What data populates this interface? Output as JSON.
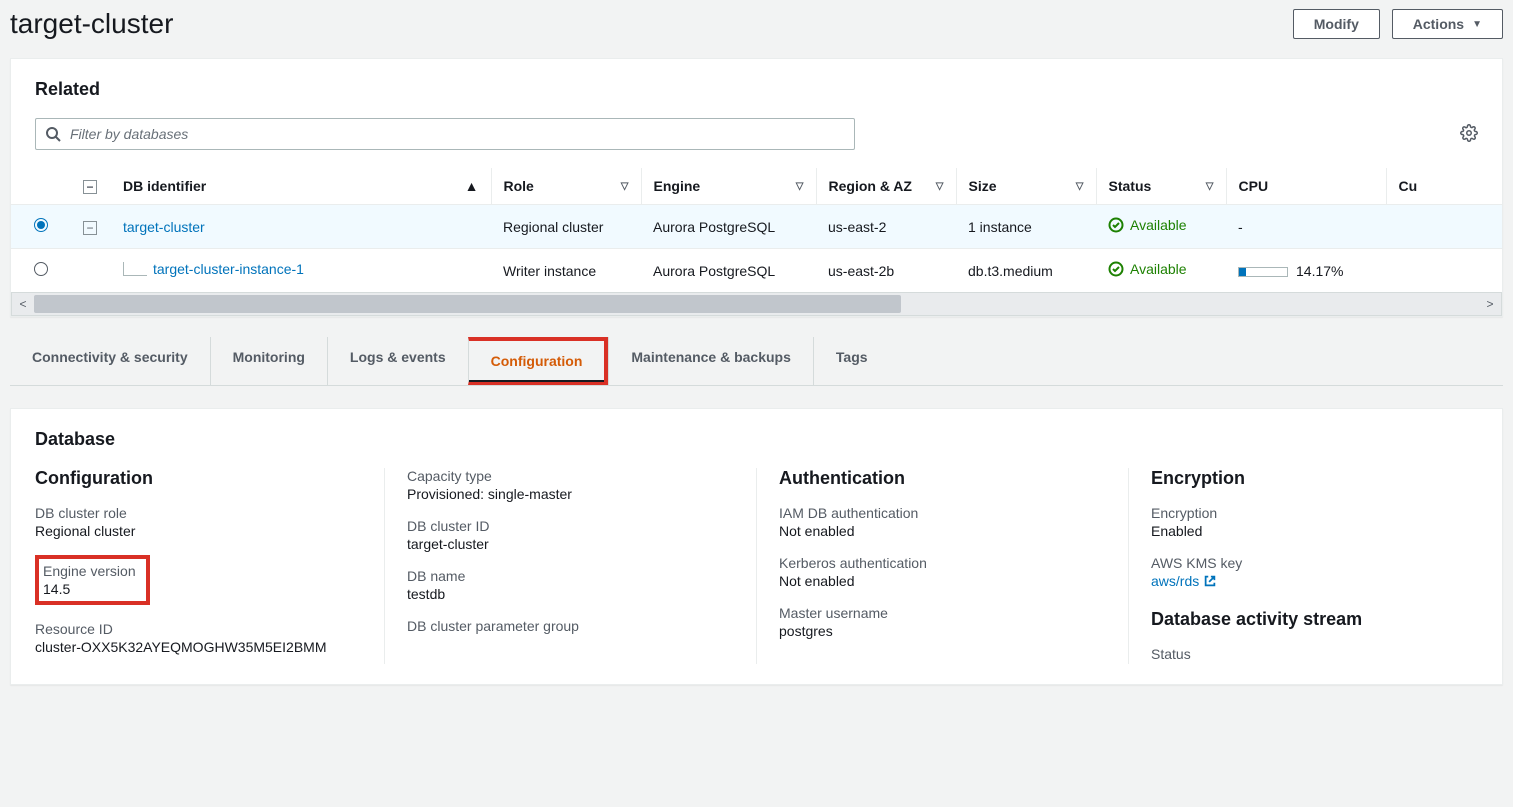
{
  "header": {
    "title": "target-cluster",
    "modify_label": "Modify",
    "actions_label": "Actions"
  },
  "related": {
    "title": "Related",
    "search_placeholder": "Filter by databases",
    "columns": {
      "db_identifier": "DB identifier",
      "role": "Role",
      "engine": "Engine",
      "region_az": "Region & AZ",
      "size": "Size",
      "status": "Status",
      "cpu": "CPU",
      "cu": "Cu"
    },
    "rows": [
      {
        "selected": true,
        "db_identifier": "target-cluster",
        "role": "Regional cluster",
        "engine": "Aurora PostgreSQL",
        "region_az": "us-east-2",
        "size": "1 instance",
        "status": "Available",
        "cpu": "-",
        "cpu_pct": null
      },
      {
        "selected": false,
        "db_identifier": "target-cluster-instance-1",
        "role": "Writer instance",
        "engine": "Aurora PostgreSQL",
        "region_az": "us-east-2b",
        "size": "db.t3.medium",
        "status": "Available",
        "cpu": "14.17%",
        "cpu_pct": 14.17
      }
    ]
  },
  "tabs": {
    "connectivity": "Connectivity & security",
    "monitoring": "Monitoring",
    "logs": "Logs & events",
    "configuration": "Configuration",
    "maintenance": "Maintenance & backups",
    "tags": "Tags"
  },
  "database": {
    "title": "Database",
    "configuration": {
      "heading": "Configuration",
      "db_cluster_role_label": "DB cluster role",
      "db_cluster_role_value": "Regional cluster",
      "engine_version_label": "Engine version",
      "engine_version_value": "14.5",
      "resource_id_label": "Resource ID",
      "resource_id_value": "cluster-OXX5K32AYEQMOGHW35M5EI2BMM"
    },
    "capacity": {
      "capacity_type_label": "Capacity type",
      "capacity_type_value": "Provisioned: single-master",
      "db_cluster_id_label": "DB cluster ID",
      "db_cluster_id_value": "target-cluster",
      "db_name_label": "DB name",
      "db_name_value": "testdb",
      "param_group_label": "DB cluster parameter group"
    },
    "authentication": {
      "heading": "Authentication",
      "iam_label": "IAM DB authentication",
      "iam_value": "Not enabled",
      "kerberos_label": "Kerberos authentication",
      "kerberos_value": "Not enabled",
      "master_user_label": "Master username",
      "master_user_value": "postgres"
    },
    "encryption": {
      "heading": "Encryption",
      "enc_label": "Encryption",
      "enc_value": "Enabled",
      "kms_label": "AWS KMS key",
      "kms_value": "aws/rds",
      "activity_heading": "Database activity stream",
      "status_label": "Status"
    }
  }
}
